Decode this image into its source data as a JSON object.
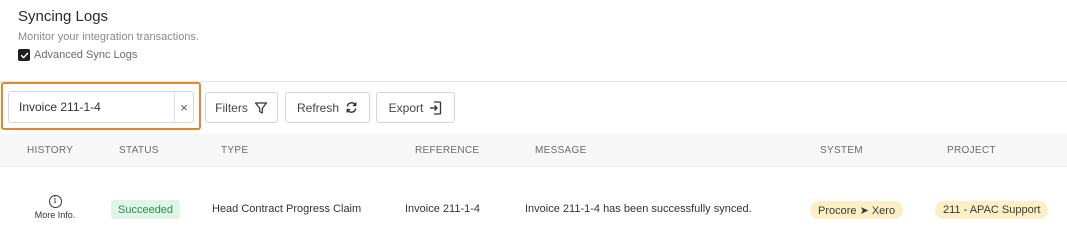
{
  "page": {
    "title": "Syncing Logs",
    "subtitle": "Monitor your integration transactions.",
    "advanced_sync_logs_label": "Advanced Sync Logs",
    "advanced_sync_logs_checked": true
  },
  "toolbar": {
    "search_value": "Invoice 211-1-4",
    "clear_label": "×",
    "filters_label": "Filters",
    "refresh_label": "Refresh",
    "export_label": "Export"
  },
  "table": {
    "headers": {
      "history": "HISTORY",
      "status": "STATUS",
      "type": "TYPE",
      "reference": "REFERENCE",
      "message": "MESSAGE",
      "system": "SYSTEM",
      "project": "PROJECT"
    },
    "rows": [
      {
        "history_label": "More Info.",
        "status": "Succeeded",
        "type": "Head Contract Progress Claim",
        "reference": "Invoice 211-1-4",
        "message": "Invoice 211-1-4 has been successfully synced.",
        "system": "Procore ➤ Xero",
        "project": "211 - APAC Support"
      }
    ]
  },
  "colors": {
    "highlight_outline": "#e0872f",
    "status_success_bg": "#dff5e6",
    "status_success_text": "#2e8a4f",
    "pill_bg": "#fbf0c4"
  },
  "icons": {
    "checkbox": "check-icon",
    "clear": "close-icon",
    "filters": "filter-funnel-icon",
    "refresh": "refresh-arrows-icon",
    "export": "export-file-icon",
    "history": "info-circle-icon"
  }
}
